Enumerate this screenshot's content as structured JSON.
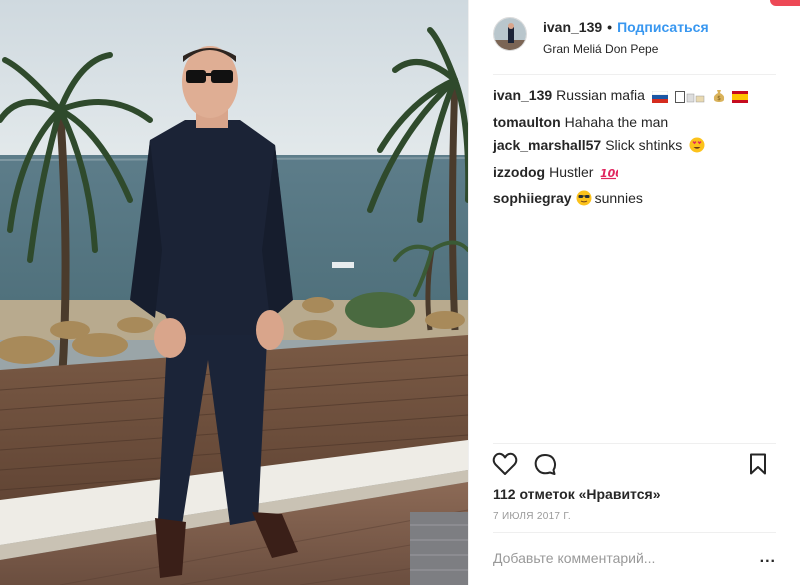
{
  "post": {
    "image_alt": "",
    "author": {
      "username": "ivan_139",
      "follow_label": "Подписаться",
      "separator": "•",
      "location": "Gran Meliá Don Pepe"
    }
  },
  "comments": [
    {
      "user": "ivan_139",
      "text": "Russian mafia",
      "emoji": [
        "flag-russia",
        "fist-bump",
        "money-bag",
        "flag-spain"
      ]
    },
    {
      "user": "tomaulton",
      "text": "Hahaha the man",
      "emoji": []
    },
    {
      "user": "jack_marshall57",
      "text": "Slick shtinks",
      "emoji": [
        "heart-eyes-face"
      ]
    },
    {
      "user": "izzodog",
      "text": "Hustler",
      "emoji": [
        "hundred-points"
      ]
    },
    {
      "user": "sophiiegray",
      "text": "sunnies",
      "emoji": [
        "sunglasses-face"
      ],
      "emoji_first": true
    }
  ],
  "actions": {
    "likes": "112 отметок «Нравится»",
    "date": "7 ИЮЛЯ 2017 Г."
  },
  "comment_box": {
    "placeholder": "Добавьте комментарий...",
    "more_label": "..."
  },
  "colors": {
    "link": "#3897f0",
    "text": "#262626",
    "muted": "#999999",
    "notification": "#ed4956"
  }
}
